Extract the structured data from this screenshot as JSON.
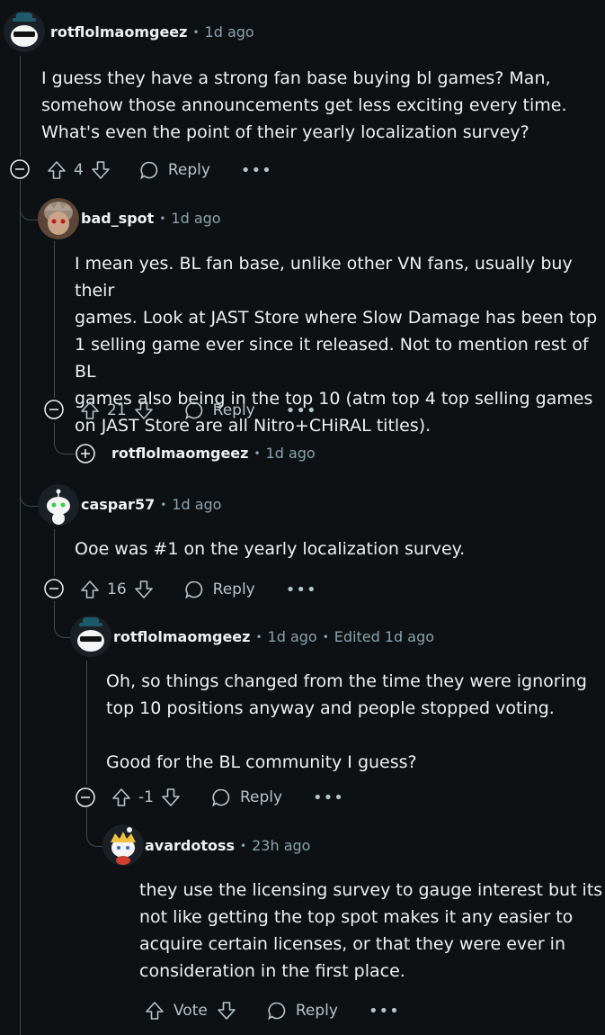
{
  "comments": [
    {
      "user": "rotflolmaomgeez",
      "dot": "•",
      "time": "1d ago",
      "text": "I guess they have a strong fan base buying bl games? Man,\nsomehow those announcements get less exciting every time.\nWhat's even the point of their yearly localization survey?",
      "votes": "4",
      "reply": "Reply",
      "more": "•••"
    },
    {
      "user": "bad_spot",
      "dot": "•",
      "time": "1d ago",
      "text": "I mean yes. BL fan base, unlike other VN fans, usually buy their\ngames. Look at JAST Store where Slow Damage has been top\n1 selling game ever since it released. Not to mention rest of BL\ngames also being in the top 10 (atm top 4 top selling games\non JAST Store are all Nitro+CHiRAL titles).",
      "votes": "21",
      "reply": "Reply",
      "more": "•••"
    },
    {
      "user": "rotflolmaomgeez",
      "dot": "•",
      "time": "1d ago",
      "collapsed": true
    },
    {
      "user": "caspar57",
      "dot": "•",
      "time": "1d ago",
      "text": "Ooe was #1 on the yearly localization survey.",
      "votes": "16",
      "reply": "Reply",
      "more": "•••"
    },
    {
      "user": "rotflolmaomgeez",
      "dot": "•",
      "time": "1d ago",
      "edited": "Edited 1d ago",
      "text": "Oh, so things changed from the time they were ignoring\ntop 10 positions anyway and people stopped voting.\n\nGood for the BL community I guess?",
      "votes": "-1",
      "reply": "Reply",
      "more": "•••"
    },
    {
      "user": "avardotoss",
      "dot": "•",
      "time": "23h ago",
      "text": "they use the licensing survey to gauge interest but its\nnot like getting the top spot makes it any easier to\nacquire certain licenses, or that they were ever in\nconsideration in the first place.",
      "votes": "Vote",
      "reply": "Reply",
      "more": "•••"
    }
  ],
  "icons": [
    "collapse-icon",
    "expand-icon",
    "upvote-icon",
    "downvote-icon",
    "reply-icon",
    "more-options-icon"
  ],
  "colors": {
    "background": "#0e1113",
    "text": "#eef1f3",
    "muted": "#8ba2ad",
    "thread_line": "#3e4a52"
  }
}
